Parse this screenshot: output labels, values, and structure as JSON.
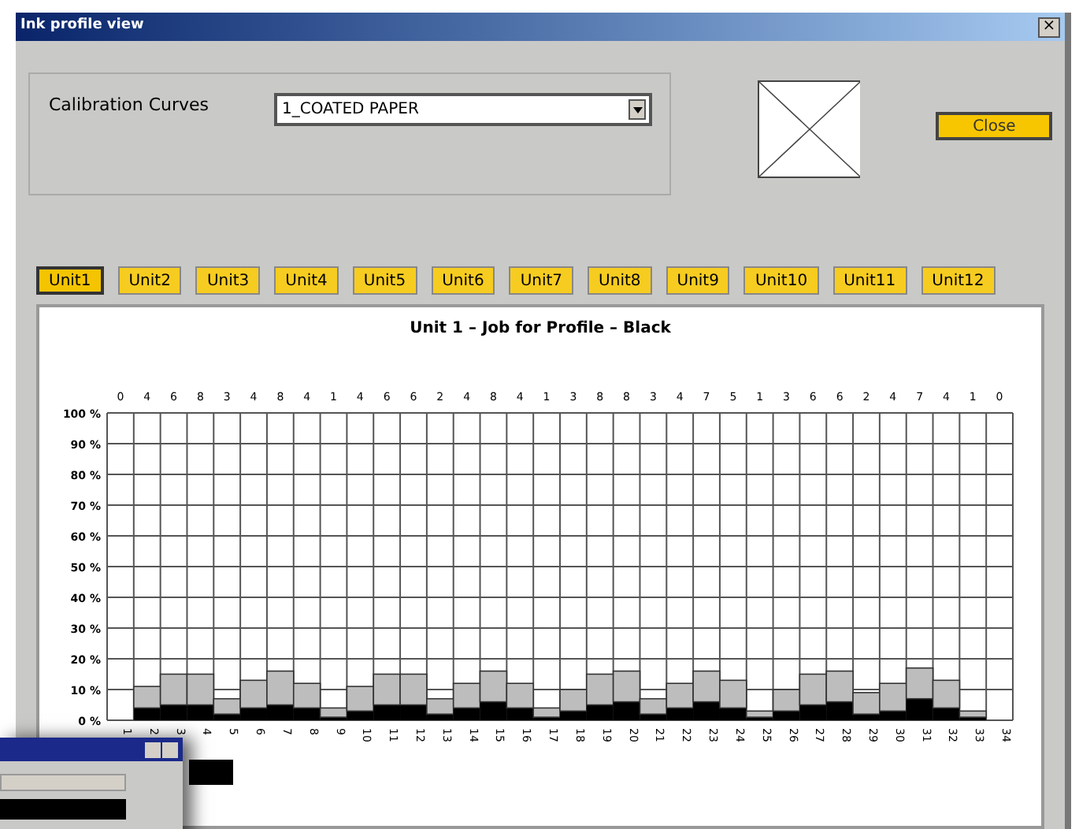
{
  "window": {
    "title": "Ink profile view",
    "close": "×"
  },
  "calibration": {
    "label": "Calibration Curves",
    "value": "1_COATED PAPER"
  },
  "close_button": "Close",
  "tabs": [
    {
      "label": "Unit1",
      "selected": true
    },
    {
      "label": "Unit2",
      "selected": false
    },
    {
      "label": "Unit3",
      "selected": false
    },
    {
      "label": "Unit4",
      "selected": false
    },
    {
      "label": "Unit5",
      "selected": false
    },
    {
      "label": "Unit6",
      "selected": false
    },
    {
      "label": "Unit7",
      "selected": false
    },
    {
      "label": "Unit8",
      "selected": false
    },
    {
      "label": "Unit9",
      "selected": false
    },
    {
      "label": "Unit10",
      "selected": false
    },
    {
      "label": "Unit11",
      "selected": false
    },
    {
      "label": "Unit12",
      "selected": false
    }
  ],
  "chart": {
    "zone_labels": [
      "0",
      "4",
      "6",
      "8",
      "3",
      "4",
      "8",
      "4",
      "1",
      "4",
      "6",
      "6",
      "2",
      "4",
      "8",
      "4",
      "1",
      "3",
      "8",
      "8",
      "3",
      "4",
      "7",
      "5",
      "1",
      "3",
      "6",
      "6",
      "2",
      "4",
      "7",
      "4",
      "1",
      "0"
    ],
    "chart_data": {
      "type": "bar",
      "stacked": true,
      "grid": true,
      "title": "Unit 1 – Job for Profile –  Black",
      "categories": [
        "1",
        "2",
        "3",
        "4",
        "5",
        "6",
        "7",
        "8",
        "9",
        "10",
        "11",
        "12",
        "13",
        "14",
        "15",
        "16",
        "17",
        "18",
        "19",
        "20",
        "21",
        "22",
        "23",
        "24",
        "25",
        "26",
        "27",
        "28",
        "29",
        "30",
        "31",
        "32",
        "33",
        "34"
      ],
      "series": [
        {
          "color": "#000000",
          "values": [
            0,
            4,
            5,
            5,
            2,
            4,
            5,
            4,
            1,
            3,
            5,
            5,
            2,
            4,
            6,
            4,
            1,
            3,
            5,
            6,
            2,
            4,
            6,
            4,
            1,
            3,
            5,
            6,
            2,
            3,
            7,
            4,
            1,
            0
          ]
        },
        {
          "color": "#bdbdbd",
          "values": [
            0,
            7,
            10,
            10,
            5,
            9,
            11,
            8,
            3,
            8,
            10,
            10,
            5,
            8,
            10,
            8,
            3,
            7,
            10,
            10,
            5,
            8,
            10,
            9,
            2,
            7,
            10,
            10,
            7,
            9,
            10,
            9,
            2,
            0
          ]
        }
      ],
      "ylim": [
        0,
        100
      ],
      "yticks": [
        {
          "value": 0,
          "label": "0 %"
        },
        {
          "value": 10,
          "label": "10 %"
        },
        {
          "value": 20,
          "label": "20 %"
        },
        {
          "value": 30,
          "label": "30 %"
        },
        {
          "value": 40,
          "label": "40 %"
        },
        {
          "value": 50,
          "label": "50 %"
        },
        {
          "value": 60,
          "label": "60 %"
        },
        {
          "value": 70,
          "label": "70 %"
        },
        {
          "value": 80,
          "label": "80 %"
        },
        {
          "value": 90,
          "label": "90 %"
        },
        {
          "value": 100,
          "label": "100 %"
        }
      ]
    }
  }
}
